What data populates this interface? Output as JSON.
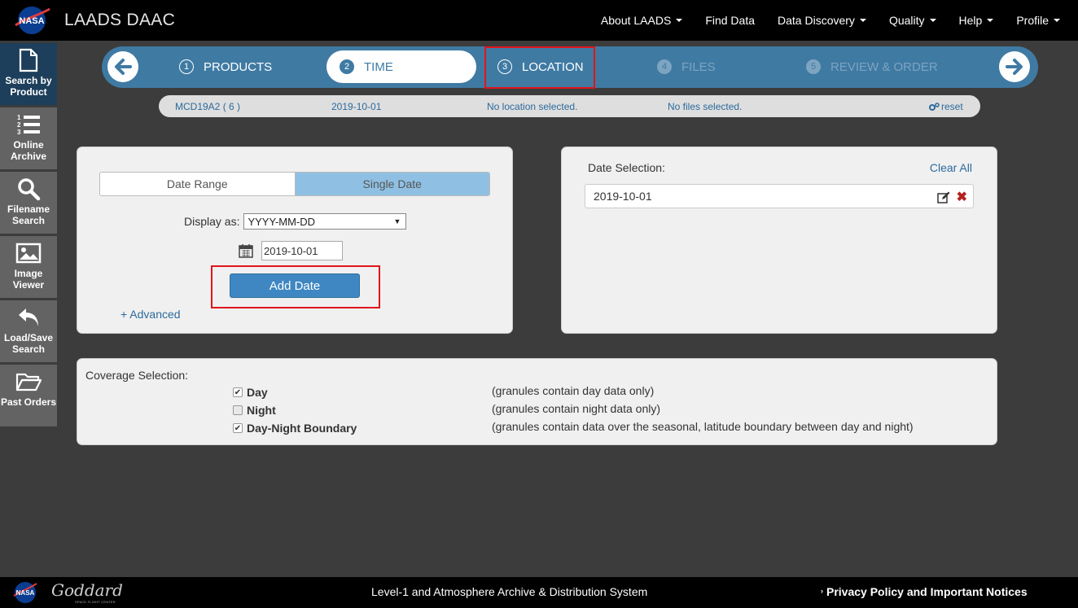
{
  "header": {
    "title": "LAADS DAAC",
    "menu": [
      "About LAADS",
      "Find Data",
      "Data Discovery",
      "Quality",
      "Help",
      "Profile"
    ]
  },
  "sidebar": {
    "items": [
      {
        "label": "Search by\nProduct",
        "icon": "document-icon"
      },
      {
        "label": "Online\nArchive",
        "icon": "numbered-list-icon"
      },
      {
        "label": "Filename\nSearch",
        "icon": "search-icon"
      },
      {
        "label": "Image\nViewer",
        "icon": "image-icon"
      },
      {
        "label": "Load/Save\nSearch",
        "icon": "undo-icon"
      },
      {
        "label": "Past Orders",
        "icon": "folder-icon"
      }
    ]
  },
  "stepper": {
    "steps": [
      {
        "num": "1",
        "label": "PRODUCTS"
      },
      {
        "num": "2",
        "label": "TIME"
      },
      {
        "num": "3",
        "label": "LOCATION"
      },
      {
        "num": "4",
        "label": "FILES"
      },
      {
        "num": "5",
        "label": "REVIEW & ORDER"
      }
    ]
  },
  "summary": {
    "product": "MCD19A2 ( 6 )",
    "date": "2019-10-01",
    "location": "No location selected.",
    "files": "No files selected.",
    "reset": "reset"
  },
  "time_panel": {
    "toggle_range": "Date Range",
    "toggle_single": "Single Date",
    "display_as_label": "Display as:",
    "display_as_value": "YYYY-MM-DD",
    "date_value": "2019-10-01",
    "add_date": "Add Date",
    "advanced": "+ Advanced"
  },
  "date_selection": {
    "label": "Date Selection:",
    "clear_all": "Clear All",
    "items": [
      "2019-10-01"
    ]
  },
  "coverage": {
    "label": "Coverage Selection:",
    "options": [
      {
        "name": "Day",
        "checked": true,
        "desc": "(granules contain day data only)"
      },
      {
        "name": "Night",
        "checked": false,
        "desc": "(granules contain night data only)"
      },
      {
        "name": "Day-Night Boundary",
        "checked": true,
        "desc": "(granules contain data over the seasonal, latitude boundary between day and night)"
      }
    ]
  },
  "footer": {
    "center": "Level-1 and Atmosphere Archive & Distribution System",
    "right": "Privacy Policy and Important Notices",
    "goddard": "Goddard",
    "goddard_sub": "SPACE FLIGHT CENTER"
  },
  "colors": {
    "stepper_bg": "#3f7aa3",
    "accent_link": "#2c6a9c",
    "highlight": "#e1141c",
    "button": "#3f87c2"
  }
}
